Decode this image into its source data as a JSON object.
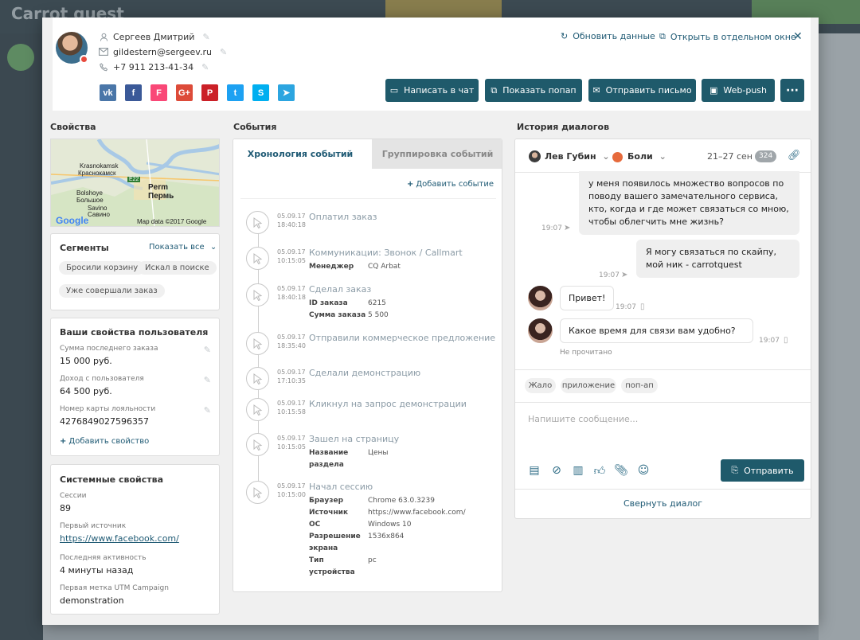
{
  "background": {
    "logo": "Carrot quest"
  },
  "user": {
    "name": "Сергеев Дмитрий",
    "email": "gildestern@sergeev.ru",
    "phone": "+7 911 213-41-34"
  },
  "socials": [
    {
      "name": "vk",
      "glyph": "vk",
      "color": "#4a76a8"
    },
    {
      "name": "facebook",
      "glyph": "f",
      "color": "#3b5998"
    },
    {
      "name": "foursquare",
      "glyph": "F",
      "color": "#f94877"
    },
    {
      "name": "google-plus",
      "glyph": "G+",
      "color": "#dd4b39"
    },
    {
      "name": "pinterest",
      "glyph": "P",
      "color": "#cb2027"
    },
    {
      "name": "twitter",
      "glyph": "t",
      "color": "#1da1f2"
    },
    {
      "name": "skype",
      "glyph": "S",
      "color": "#00aff0"
    },
    {
      "name": "telegram",
      "glyph": "➤",
      "color": "#2ca5e0"
    }
  ],
  "header": {
    "refresh": "Обновить данные",
    "open_window": "Открыть в отдельном окне"
  },
  "actions": {
    "chat": "Написать в чат",
    "popup": "Показать попап",
    "email": "Отправить письмо",
    "webpush": "Web-push",
    "more": "···"
  },
  "properties": {
    "title": "Свойства",
    "map": {
      "krasnokamsk_lat": "Krasnokamsk",
      "krasnokamsk": "Краснокамск",
      "perm_lat": "Perm",
      "perm": "Пермь",
      "bolshoye": "Bolshoye",
      "bolshoe": "Большое",
      "savino": "Savino",
      "savino_ru": "Савино",
      "road": "E22",
      "google": "Google",
      "attribution": "Map data ©2017 Google"
    },
    "segments": {
      "title": "Сегменты",
      "show_all": "Показать все",
      "items": [
        "Бросили корзину",
        "Искал в поиске",
        "Уже совершали заказ"
      ]
    },
    "user_props": {
      "title": "Ваши свойства пользователя",
      "items": [
        {
          "label": "Сумма последнего заказа",
          "value": "15 000 руб."
        },
        {
          "label": "Доход с пользователя",
          "value": "64 500 руб."
        },
        {
          "label": "Номер карты лояльности",
          "value": "4276849027596357"
        }
      ],
      "add": "Добавить свойство"
    },
    "system": {
      "title": "Системные свойства",
      "items": [
        {
          "label": "Сессии",
          "value": "89"
        },
        {
          "label": "Первый источник",
          "value": "https://www.facebook.com/"
        },
        {
          "label": "Последняя активность",
          "value": "4 минуты назад"
        },
        {
          "label": "Первая метка UTM Campaign",
          "value": "demonstration"
        }
      ]
    }
  },
  "events": {
    "title": "События",
    "tab_timeline": "Хронология событий",
    "tab_group": "Группировка событий",
    "add": "Добавить событие",
    "items": [
      {
        "date": "05.09.17",
        "time": "18:40:18",
        "title": "Оплатил заказ",
        "props": []
      },
      {
        "date": "05.09.17",
        "time": "10:15:05",
        "title": "Коммуникации: Звонок / Callmart",
        "props": [
          {
            "k": "Менеджер",
            "v": "CQ Arbat"
          }
        ]
      },
      {
        "date": "05.09.17",
        "time": "18:40:18",
        "title": "Сделал заказ",
        "props": [
          {
            "k": "ID заказа",
            "v": "6215"
          },
          {
            "k": "Сумма заказа",
            "v": "5 500"
          }
        ]
      },
      {
        "date": "05.09.17",
        "time": "18:35:40",
        "title": "Отправили коммерческое предложение",
        "props": []
      },
      {
        "date": "05.09.17",
        "time": "17:10:35",
        "title": "Сделали демонстрацию",
        "props": []
      },
      {
        "date": "05.09.17",
        "time": "10:15:58",
        "title": "Кликнул на запрос демонстрации",
        "props": []
      },
      {
        "date": "05.09.17",
        "time": "10:15:05",
        "title": "Зашел на страницу",
        "props": [
          {
            "k": "Название раздела",
            "v": "Цены"
          }
        ]
      },
      {
        "date": "05.09.17",
        "time": "10:15:00",
        "title": "Начал сессию",
        "props": [
          {
            "k": "Браузер",
            "v": "Chrome 63.0.3239"
          },
          {
            "k": "Источник",
            "v": "https://www.facebook.com/"
          },
          {
            "k": "ОС",
            "v": "Windows 10"
          },
          {
            "k": "Разрешение экрана",
            "v": "1536x864"
          },
          {
            "k": "Тип устройства",
            "v": "pc"
          }
        ]
      }
    ]
  },
  "dialogs": {
    "title": "История диалогов",
    "agent": "Лев Губин",
    "channel": "Боли",
    "date_range": "21–27 сен",
    "count": "324",
    "messages": [
      {
        "text": "у меня появилось множество вопросов по поводу вашего замечательного сервиса, кто, когда и где может связаться со мною, чтобы облегчить мне жизнь?",
        "time": "19:07"
      },
      {
        "text": "Я могу связаться по скайпу, мой ник - carrotquest",
        "time": "19:07"
      },
      {
        "text": "Привет!",
        "time": "19:07"
      },
      {
        "text": "Какое время для связи вам удобно?",
        "time": "19:07"
      }
    ],
    "unread": "Не прочитано",
    "tags": [
      "Жало",
      "приложение",
      "поп-ап"
    ],
    "input_placeholder": "Напишите сообщение...",
    "send": "Отправить",
    "collapse": "Свернуть диалог"
  },
  "colors": {
    "primary": "#1f5a6b",
    "link": "#1f5a74",
    "accent_orange": "#e66a3c"
  }
}
